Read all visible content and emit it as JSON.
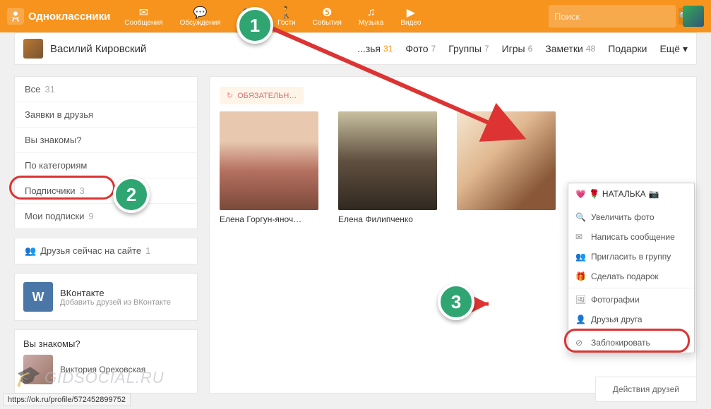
{
  "brand": "Одноклассники",
  "search": {
    "placeholder": "Поиск"
  },
  "nav": {
    "messages": "Сообщения",
    "discussions": "Обсуждения",
    "friends": "Друзья",
    "guests": "Гости",
    "events": "События",
    "music": "Музыка",
    "video": "Видео"
  },
  "profile": {
    "name": "Василий Кировский"
  },
  "tabs": {
    "friends": {
      "label": "...зья",
      "count": "31"
    },
    "photo": {
      "label": "Фото",
      "count": "7"
    },
    "groups": {
      "label": "Группы",
      "count": "7"
    },
    "games": {
      "label": "Игры",
      "count": "6"
    },
    "notes": {
      "label": "Заметки",
      "count": "48"
    },
    "gifts": {
      "label": "Подарки"
    },
    "more": {
      "label": "Ещё ▾"
    }
  },
  "sidebar": {
    "all": {
      "label": "Все",
      "count": "31"
    },
    "requests": "Заявки в друзья",
    "doyouknow": "Вы знакомы?",
    "categories": "По категориям",
    "subscribers": {
      "label": "Подписчики",
      "count": "3"
    },
    "subscriptions": {
      "label": "Мои подписки",
      "count": "9"
    },
    "online": {
      "label": "Друзья сейчас на сайте",
      "count": "1"
    }
  },
  "vk": {
    "title": "ВКонтакте",
    "subtitle": "Добавить друзей из ВКонтакте"
  },
  "suggest": {
    "title": "Вы знакомы?",
    "name": "Виктория Ореховская"
  },
  "req_badge": "ОБЯЗАТЕЛЬН…",
  "friends": [
    {
      "name": "Елена Горгун-яноч…"
    },
    {
      "name": "Елена Филипченко"
    },
    {
      "name": "НАТАЛЬКА"
    }
  ],
  "context_menu": {
    "header": "НАТАЛЬКА",
    "items": {
      "zoom": "Увеличить фото",
      "message": "Написать сообщение",
      "invite": "Пригласить в группу",
      "gift": "Сделать подарок",
      "photos": "Фотографии",
      "mutual": "Друзья друга",
      "block": "Заблокировать"
    }
  },
  "bottom_right": "Действия друзей",
  "status_url": "https://ok.ru/profile/572452899752",
  "watermark": "GIDSOCIAL.RU",
  "anno": {
    "n1": "1",
    "n2": "2",
    "n3": "3"
  }
}
